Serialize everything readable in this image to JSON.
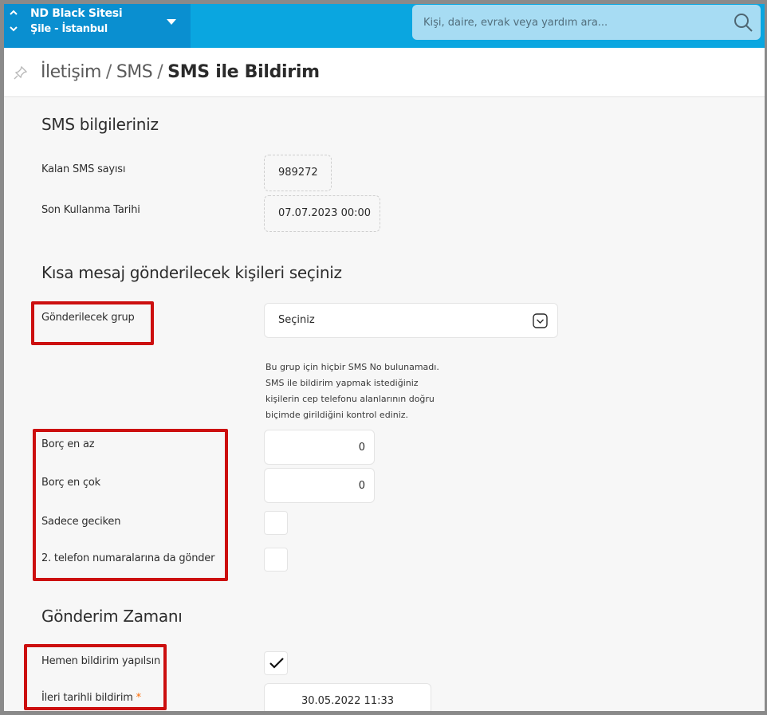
{
  "topbar": {
    "site_name": "ND Black Sitesi",
    "site_location": "Şile - İstanbul",
    "search_placeholder": "Kişi, daire, evrak veya yardım ara..."
  },
  "breadcrumb": {
    "item1": "İletişim",
    "item2": "SMS",
    "current": "SMS ile Bildirim",
    "separator": "/"
  },
  "sms_info": {
    "title": "SMS bilgileriniz",
    "remaining_label": "Kalan SMS sayısı",
    "remaining_value": "989272",
    "expiry_label": "Son Kullanma Tarihi",
    "expiry_value": "07.07.2023 00:00"
  },
  "recipients": {
    "title": "Kısa mesaj gönderilecek kişileri seçiniz",
    "group_label": "Gönderilecek grup",
    "group_value": "Seçiniz",
    "help_line1": "Bu grup için hiçbir SMS No bulunamadı.",
    "help_line2": "SMS ile bildirim yapmak istediğiniz",
    "help_line3": "kişilerin cep telefonu alanlarının doğru",
    "help_line4": "biçimde girildiğini kontrol ediniz.",
    "debt_min_label": "Borç en az",
    "debt_min_value": "0",
    "debt_max_label": "Borç en çok",
    "debt_max_value": "0",
    "late_only_label": "Sadece geciken",
    "late_only_checked": false,
    "second_phone_label": "2. telefon numaralarına da gönder",
    "second_phone_checked": false
  },
  "schedule": {
    "title": "Gönderim Zamanı",
    "immediate_label": "Hemen bildirim yapılsın",
    "immediate_checked": true,
    "future_label": "İleri tarihli bildirim",
    "future_required_mark": "*",
    "future_value": "30.05.2022 11:33"
  },
  "colors": {
    "topbar": "#0aa6e0",
    "site_switcher": "#0a8fd0",
    "search_bg": "#a7dcf3",
    "highlight": "#cc0f0f",
    "required": "#ff6a00"
  }
}
